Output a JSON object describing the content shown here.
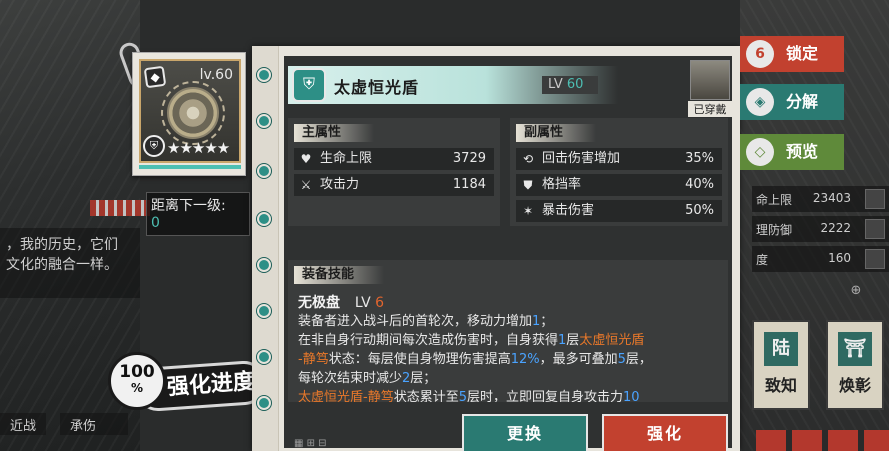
{
  "background": {
    "story_lines": [
      "，我的历史，它们",
      "文化的融合一样。"
    ],
    "stats": [
      {
        "label": "命上限",
        "value": "23403"
      },
      {
        "label": "理防御",
        "value": "2222"
      },
      {
        "label": "度",
        "value": "160"
      }
    ],
    "cards": [
      {
        "glyph": "陆",
        "label": "致知"
      },
      {
        "glyph": "⛩",
        "label": "焕彰"
      }
    ],
    "tabs": [
      "近战",
      "承伤"
    ]
  },
  "equipment_card": {
    "level": "lv.60",
    "stars": "★★★★★"
  },
  "next_level": {
    "label": "距离下一级:",
    "value": "0"
  },
  "progress": {
    "value": "100",
    "unit": "%",
    "label": "强化进度"
  },
  "item": {
    "name": "太虚恒光盾",
    "lv_label": "LV",
    "lv_value": "60",
    "equipped_label": "已穿戴"
  },
  "main_attributes": {
    "heading": "主属性",
    "rows": [
      {
        "icon": "heart-icon",
        "label": "生命上限",
        "value": "3729"
      },
      {
        "icon": "crossed-swords-icon",
        "label": "攻击力",
        "value": "1184"
      }
    ]
  },
  "sub_attributes": {
    "heading": "副属性",
    "rows": [
      {
        "icon": "counter-icon",
        "label": "回击伤害增加",
        "value": "35%"
      },
      {
        "icon": "block-icon",
        "label": "格挡率",
        "value": "40%"
      },
      {
        "icon": "crit-icon",
        "label": "暴击伤害",
        "value": "50%"
      }
    ]
  },
  "skill": {
    "heading": "装备技能",
    "name": "无极盘",
    "lv_label": "LV",
    "lv_value": "6",
    "line1_a": "装备者进入战斗后的首轮次，移动力增加",
    "line1_b": "1",
    "line1_c": "；",
    "line2_a": "在非自身行动期间每次造成伤害时，自身获得",
    "line2_b": "1",
    "line2_c": "层",
    "line2_d": "太虚恒光盾",
    "line3_a": "-静笃",
    "line3_b": "状态：每层使自身物理伤害提高",
    "line3_c": "12%",
    "line3_d": "，最多可叠加",
    "line3_e": "5",
    "line3_f": "层，",
    "line4_a": "每轮次结束时减少",
    "line4_b": "2",
    "line4_c": "层；",
    "line5_a": "太虚恒光盾-静笃",
    "line5_b": "状态累计至",
    "line5_c": "5",
    "line5_d": "层时，立即回复自身攻击力",
    "line5_e": "10"
  },
  "buttons": {
    "replace": "更换",
    "enhance": "强化"
  },
  "side_actions": {
    "lock": "锁定",
    "decompose": "分解",
    "preview": "预览"
  },
  "colors": {
    "teal": "#2a7a72",
    "red": "#c2412f",
    "green": "#5f8a3a",
    "highlight_blue": "#4aa3ff",
    "highlight_orange": "#e8782a"
  }
}
